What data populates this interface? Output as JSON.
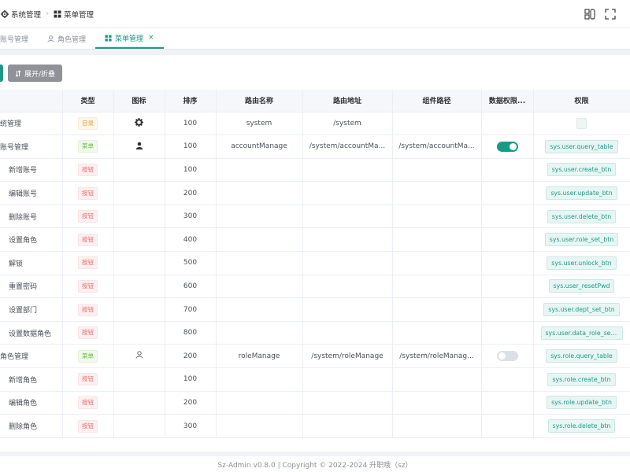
{
  "breadcrumb": {
    "items": [
      {
        "label": "系统管理",
        "icon": "gear-icon"
      },
      {
        "label": "菜单管理",
        "icon": "grid-icon"
      }
    ]
  },
  "header": {
    "right_icons": [
      "layout-icon",
      "fullscreen-icon"
    ]
  },
  "tabs": [
    {
      "label": "账号管理",
      "icon": "",
      "active": false
    },
    {
      "label": "角色管理",
      "icon": "user-outline-icon",
      "active": false
    },
    {
      "label": "菜单管理",
      "icon": "grid-icon",
      "active": true,
      "close": "×"
    }
  ],
  "toolbar": {
    "expand_label": "展开/折叠"
  },
  "table": {
    "columns": [
      "",
      "类型",
      "图标",
      "排序",
      "路由名称",
      "路由地址",
      "组件路径",
      "数据权限...",
      "权限"
    ],
    "rows": [
      {
        "name": "统管理",
        "type": "目录",
        "icon": "gear-icon",
        "sort": "100",
        "route_name": "system",
        "route_path": "/system",
        "component": "",
        "data_perm": "",
        "perm": "",
        "child": false
      },
      {
        "name": "账号管理",
        "type": "菜单",
        "icon": "user-filled-icon",
        "sort": "100",
        "route_name": "accountManage",
        "route_path": "/system/accountMa...",
        "component": "/system/accountMa...",
        "data_perm": "on",
        "perm": "sys.user.query_table",
        "child": false
      },
      {
        "name": "新增账号",
        "type": "按钮",
        "icon": "",
        "sort": "100",
        "route_name": "",
        "route_path": "",
        "component": "",
        "data_perm": "",
        "perm": "sys.user.create_btn",
        "child": true
      },
      {
        "name": "编辑账号",
        "type": "按钮",
        "icon": "",
        "sort": "200",
        "route_name": "",
        "route_path": "",
        "component": "",
        "data_perm": "",
        "perm": "sys.user.update_btn",
        "child": true
      },
      {
        "name": "删除账号",
        "type": "按钮",
        "icon": "",
        "sort": "300",
        "route_name": "",
        "route_path": "",
        "component": "",
        "data_perm": "",
        "perm": "sys.user.delete_btn",
        "child": true
      },
      {
        "name": "设置角色",
        "type": "按钮",
        "icon": "",
        "sort": "400",
        "route_name": "",
        "route_path": "",
        "component": "",
        "data_perm": "",
        "perm": "sys.user.role_set_btn",
        "child": true
      },
      {
        "name": "解锁",
        "type": "按钮",
        "icon": "",
        "sort": "500",
        "route_name": "",
        "route_path": "",
        "component": "",
        "data_perm": "",
        "perm": "sys.user.unlock_btn",
        "child": true
      },
      {
        "name": "重置密码",
        "type": "按钮",
        "icon": "",
        "sort": "600",
        "route_name": "",
        "route_path": "",
        "component": "",
        "data_perm": "",
        "perm": "sys.user_resetPwd",
        "child": true
      },
      {
        "name": "设置部门",
        "type": "按钮",
        "icon": "",
        "sort": "700",
        "route_name": "",
        "route_path": "",
        "component": "",
        "data_perm": "",
        "perm": "sys.user.dept_set_btn",
        "child": true
      },
      {
        "name": "设置数据角色",
        "type": "按钮",
        "icon": "",
        "sort": "800",
        "route_name": "",
        "route_path": "",
        "component": "",
        "data_perm": "",
        "perm": "sys.user.data_role_set_btn",
        "child": true
      },
      {
        "name": "角色管理",
        "type": "菜单",
        "icon": "user-outline-icon",
        "sort": "200",
        "route_name": "roleManage",
        "route_path": "/system/roleManage",
        "component": "/system/roleManag...",
        "data_perm": "off",
        "perm": "sys.role.query_table",
        "child": false
      },
      {
        "name": "新增角色",
        "type": "按钮",
        "icon": "",
        "sort": "100",
        "route_name": "",
        "route_path": "",
        "component": "",
        "data_perm": "",
        "perm": "sys.role.create_btn",
        "child": true
      },
      {
        "name": "编辑角色",
        "type": "按钮",
        "icon": "",
        "sort": "200",
        "route_name": "",
        "route_path": "",
        "component": "",
        "data_perm": "",
        "perm": "sys.role.update_btn",
        "child": true
      },
      {
        "name": "删除角色",
        "type": "按钮",
        "icon": "",
        "sort": "300",
        "route_name": "",
        "route_path": "",
        "component": "",
        "data_perm": "",
        "perm": "sys.role.delete_btn",
        "child": true
      }
    ]
  },
  "footer": {
    "text": "Sz-Admin v0.8.0 | Copyright © 2022-2024 升职哦（sz）"
  },
  "colors": {
    "primary": "#1a9a85",
    "dir_tag": "#e6a23c",
    "menu_tag": "#67c23a",
    "button_tag": "#f56c6c"
  }
}
